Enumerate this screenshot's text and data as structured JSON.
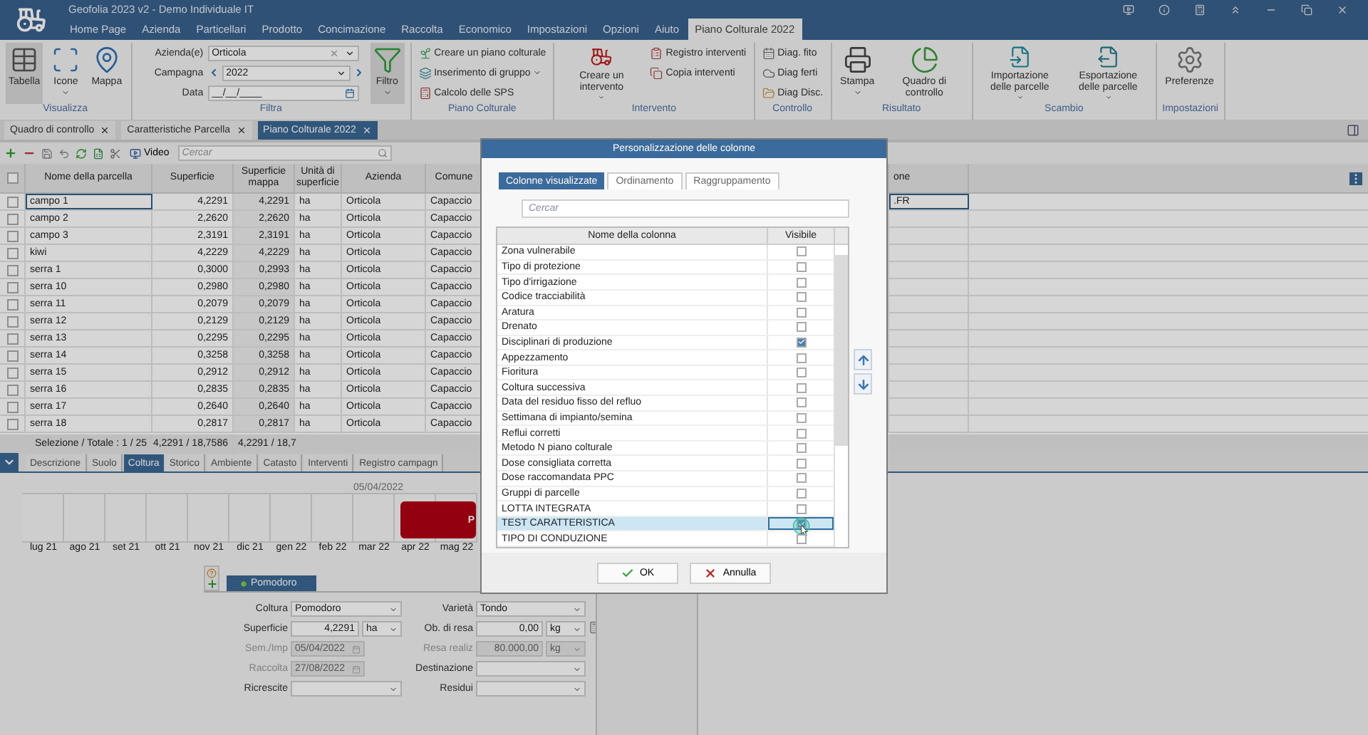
{
  "window": {
    "title": "Geofolia 2023 v2 - Demo Individuale IT"
  },
  "menu": [
    {
      "label": "Home Page",
      "selected": false
    },
    {
      "label": "Azienda",
      "selected": false
    },
    {
      "label": "Particellari",
      "selected": false
    },
    {
      "label": "Prodotto",
      "selected": false
    },
    {
      "label": "Concimazione",
      "selected": false
    },
    {
      "label": "Raccolta",
      "selected": false
    },
    {
      "label": "Economico",
      "selected": false
    },
    {
      "label": "Impostazioni",
      "selected": false
    },
    {
      "label": "Opzioni",
      "selected": false
    },
    {
      "label": "Aiuto",
      "selected": false
    },
    {
      "label": "Piano Colturale 2022",
      "selected": true
    }
  ],
  "ribbon": [
    {
      "label": "Visualizza",
      "items": [
        {
          "kind": "large",
          "label": "Tabella",
          "selected": true,
          "dropdown": false
        },
        {
          "kind": "large",
          "label": "Icone",
          "selected": false,
          "dropdown": true
        },
        {
          "kind": "large",
          "label": "Mappa",
          "selected": false,
          "dropdown": false
        }
      ]
    },
    {
      "label": "Filtra",
      "items": [
        {
          "kind": "combo",
          "label": "Azienda(e)",
          "value": "Orticola"
        },
        {
          "kind": "stepper",
          "label": "Campagna",
          "value": "2022"
        },
        {
          "kind": "date",
          "label": "Data",
          "value": "__/__/____"
        },
        {
          "kind": "large",
          "label": "Filtro",
          "selected": true,
          "dropdown": true
        }
      ]
    },
    {
      "label": "Piano Colturale",
      "items": [
        {
          "kind": "small",
          "label": "Creare un piano colturale",
          "dropdown": false
        },
        {
          "kind": "small",
          "label": "Inserimento di gruppo",
          "dropdown": true
        },
        {
          "kind": "small",
          "label": "Calcolo delle SPS",
          "dropdown": false
        }
      ]
    },
    {
      "label": "Intervento",
      "items": [
        {
          "kind": "large",
          "label": "Creare un intervento",
          "selected": false,
          "dropdown": true
        },
        {
          "kind": "small",
          "label": "Registro interventi",
          "dropdown": false
        },
        {
          "kind": "small",
          "label": "Copia interventi",
          "dropdown": false
        }
      ]
    },
    {
      "label": "Controllo",
      "items": [
        {
          "kind": "small",
          "label": "Diag. fito",
          "dropdown": false
        },
        {
          "kind": "small",
          "label": "Diag ferti",
          "dropdown": false
        },
        {
          "kind": "small",
          "label": "Diag Disc.",
          "dropdown": false
        }
      ]
    },
    {
      "label": "Risultato",
      "items": [
        {
          "kind": "large",
          "label": "Stampa",
          "selected": false,
          "dropdown": true
        },
        {
          "kind": "large",
          "label": "Quadro di controllo",
          "selected": false,
          "dropdown": false
        }
      ]
    },
    {
      "label": "Scambio",
      "items": [
        {
          "kind": "large",
          "label": "Importazione delle parcelle",
          "selected": false,
          "dropdown": true
        },
        {
          "kind": "large",
          "label": "Esportazione delle parcelle",
          "selected": false,
          "dropdown": true
        }
      ]
    },
    {
      "label": "Impostazioni",
      "items": [
        {
          "kind": "large",
          "label": "Preferenze",
          "selected": false,
          "dropdown": false
        }
      ]
    }
  ],
  "doc_tabs": [
    {
      "label": "Quadro di controllo",
      "selected": false
    },
    {
      "label": "Caratteristiche Parcella",
      "selected": false
    },
    {
      "label": "Piano Colturale 2022",
      "selected": true
    }
  ],
  "toolbar": {
    "video_label": "Video",
    "search": {
      "placeholder": "Cercar"
    }
  },
  "table": {
    "select_all": {
      "checked": false
    },
    "columns": [
      "Nome della parcella",
      "Superficie",
      "Superficie mappa",
      "Unità di superficie",
      "Azienda",
      "Comune",
      "one"
    ],
    "rows": [
      {
        "cells": [
          "campo 1",
          "4,2291",
          "4,2291",
          "ha",
          "Orticola",
          "Capaccio"
        ],
        "column_7": ".FR",
        "checked": false,
        "selected": true
      },
      {
        "cells": [
          "campo 2",
          "2,2620",
          "2,2620",
          "ha",
          "Orticola",
          "Capaccio"
        ],
        "checked": false,
        "selected": false
      },
      {
        "cells": [
          "campo 3",
          "2,3191",
          "2,3191",
          "ha",
          "Orticola",
          "Capaccio"
        ],
        "checked": false,
        "selected": false
      },
      {
        "cells": [
          "kiwi",
          "4,2229",
          "4,2229",
          "ha",
          "Orticola",
          "Capaccio"
        ],
        "checked": false,
        "selected": false
      },
      {
        "cells": [
          "serra 1",
          "0,3000",
          "0,2993",
          "ha",
          "Orticola",
          "Capaccio"
        ],
        "checked": false,
        "selected": false
      },
      {
        "cells": [
          "serra 10",
          "0,2980",
          "0,2980",
          "ha",
          "Orticola",
          "Capaccio"
        ],
        "checked": false,
        "selected": false
      },
      {
        "cells": [
          "serra 11",
          "0,2079",
          "0,2079",
          "ha",
          "Orticola",
          "Capaccio"
        ],
        "checked": false,
        "selected": false
      },
      {
        "cells": [
          "serra 12",
          "0,2129",
          "0,2129",
          "ha",
          "Orticola",
          "Capaccio"
        ],
        "checked": false,
        "selected": false
      },
      {
        "cells": [
          "serra 13",
          "0,2295",
          "0,2295",
          "ha",
          "Orticola",
          "Capaccio"
        ],
        "checked": false,
        "selected": false
      },
      {
        "cells": [
          "serra 14",
          "0,3258",
          "0,3258",
          "ha",
          "Orticola",
          "Capaccio"
        ],
        "checked": false,
        "selected": false
      },
      {
        "cells": [
          "serra 15",
          "0,2912",
          "0,2912",
          "ha",
          "Orticola",
          "Capaccio"
        ],
        "checked": false,
        "selected": false
      },
      {
        "cells": [
          "serra 16",
          "0,2835",
          "0,2835",
          "ha",
          "Orticola",
          "Capaccio"
        ],
        "checked": false,
        "selected": false
      },
      {
        "cells": [
          "serra 17",
          "0,2640",
          "0,2640",
          "ha",
          "Orticola",
          "Capaccio"
        ],
        "checked": false,
        "selected": false
      },
      {
        "cells": [
          "serra 18",
          "0,2817",
          "0,2817",
          "ha",
          "Orticola",
          "Capaccio"
        ],
        "checked": false,
        "selected": false
      }
    ],
    "footer": [
      "Selezione / Totale : 1 / 25",
      "4,2291 / 18,7586",
      "4,2291 / 18,7"
    ]
  },
  "detail_tabs": [
    {
      "label": "Descrizione",
      "selected": false
    },
    {
      "label": "Suolo",
      "selected": false
    },
    {
      "label": "Coltura",
      "selected": true
    },
    {
      "label": "Storico",
      "selected": false
    },
    {
      "label": "Ambiente",
      "selected": false
    },
    {
      "label": "Catasto",
      "selected": false
    },
    {
      "label": "Interventi",
      "selected": false
    },
    {
      "label": "Registro campagn",
      "selected": false
    }
  ],
  "timeline": {
    "date_label": "05/04/2022",
    "bar_label": "P",
    "months": [
      "lug 21",
      "ago 21",
      "set 21",
      "ott 21",
      "nov 21",
      "dic 21",
      "gen 22",
      "feb 22",
      "mar 22",
      "apr 22",
      "mag 22"
    ]
  },
  "crop_tab": {
    "label": "Pomodoro",
    "selected": true
  },
  "form": {
    "left": [
      {
        "kind": "combo",
        "label": "Coltura",
        "value": "Pomodoro",
        "disabled": false
      },
      {
        "kind": "number",
        "label": "Superficie",
        "value": "4,2291",
        "unit": "ha",
        "disabled": false
      },
      {
        "kind": "date",
        "label": "Sem./Imp",
        "value": "05/04/2022",
        "disabled": true
      },
      {
        "kind": "date",
        "label": "Raccolta",
        "value": "27/08/2022",
        "disabled": true
      },
      {
        "kind": "combo",
        "label": "Ricrescite",
        "disabled": false
      }
    ],
    "right": [
      {
        "kind": "combo",
        "label": "Varietà",
        "value": "Tondo",
        "disabled": false
      },
      {
        "kind": "number",
        "label": "Ob. di resa",
        "value": "0,00",
        "unit": "kg",
        "disabled": false,
        "calculator": true
      },
      {
        "kind": "number",
        "label": "Resa realiz",
        "value": "80.000,00",
        "unit": "kg",
        "disabled": true
      },
      {
        "kind": "combo",
        "label": "Destinazione",
        "disabled": false
      },
      {
        "kind": "combo",
        "label": "Residui",
        "disabled": false
      }
    ]
  },
  "dialog": {
    "title": "Personalizzazione delle colonne",
    "tabs": [
      {
        "label": "Colonne visualizzate",
        "selected": true
      },
      {
        "label": "Ordinamento",
        "selected": false
      },
      {
        "label": "Raggruppamento",
        "selected": false
      }
    ],
    "search": {
      "placeholder": "Cercar"
    },
    "columns": [
      "Nome della colonna",
      "Visibile"
    ],
    "rows": [
      {
        "name": "Zona vulnerabile",
        "checked": false,
        "selected": false
      },
      {
        "name": "Tipo di protezione",
        "checked": false,
        "selected": false
      },
      {
        "name": "Tipo d'irrigazione",
        "checked": false,
        "selected": false
      },
      {
        "name": "Codice tracciabilità",
        "checked": false,
        "selected": false
      },
      {
        "name": "Aratura",
        "checked": false,
        "selected": false
      },
      {
        "name": "Drenato",
        "checked": false,
        "selected": false
      },
      {
        "name": "Disciplinari di produzione",
        "checked": true,
        "selected": false
      },
      {
        "name": "Appezzamento",
        "checked": false,
        "selected": false
      },
      {
        "name": "Fioritura",
        "checked": false,
        "selected": false
      },
      {
        "name": "Coltura successiva",
        "checked": false,
        "selected": false
      },
      {
        "name": "Data del residuo fisso del refluo",
        "checked": false,
        "selected": false
      },
      {
        "name": "Settimana di impianto/semina",
        "checked": false,
        "selected": false
      },
      {
        "name": "Reflui corretti",
        "checked": false,
        "selected": false
      },
      {
        "name": "Metodo N piano colturale",
        "checked": false,
        "selected": false
      },
      {
        "name": "Dose consigliata corretta",
        "checked": false,
        "selected": false
      },
      {
        "name": "Dose raccomandata PPC",
        "checked": false,
        "selected": false
      },
      {
        "name": "Gruppi di parcelle",
        "checked": false,
        "selected": false
      },
      {
        "name": "LOTTA INTEGRATA",
        "checked": false,
        "selected": false
      },
      {
        "name": "TEST CARATTERISTICA",
        "checked": true,
        "selected": true
      },
      {
        "name": "TIPO DI CONDUZIONE",
        "checked": false,
        "selected": false
      }
    ],
    "buttons": [
      {
        "kind": "ok",
        "label": "OK"
      },
      {
        "kind": "cancel",
        "label": "Annulla"
      }
    ]
  }
}
